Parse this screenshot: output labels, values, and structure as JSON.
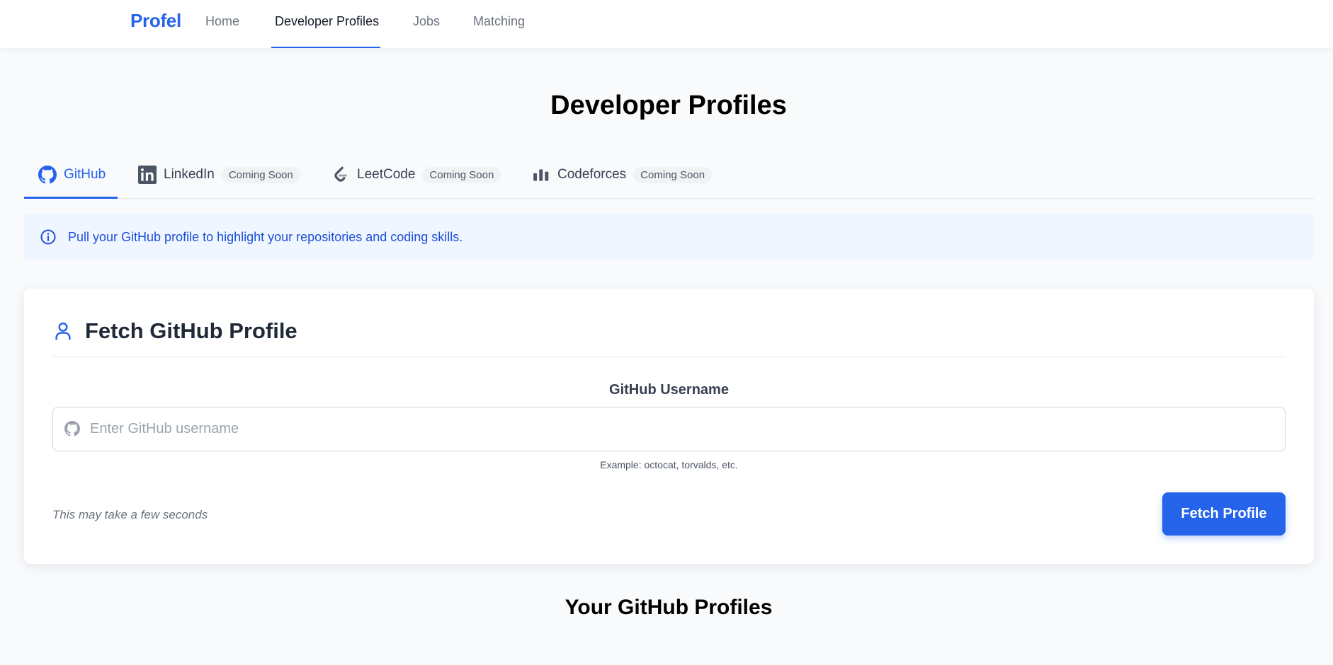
{
  "nav": {
    "brand": "Profel",
    "links": [
      {
        "label": "Home",
        "active": false
      },
      {
        "label": "Developer Profiles",
        "active": true
      },
      {
        "label": "Jobs",
        "active": false
      },
      {
        "label": "Matching",
        "active": false
      }
    ]
  },
  "page": {
    "title": "Developer Profiles"
  },
  "tabs": [
    {
      "label": "GitHub",
      "icon": "github-icon",
      "active": true,
      "badge": ""
    },
    {
      "label": "LinkedIn",
      "icon": "linkedin-icon",
      "active": false,
      "badge": "Coming Soon"
    },
    {
      "label": "LeetCode",
      "icon": "leetcode-icon",
      "active": false,
      "badge": "Coming Soon"
    },
    {
      "label": "Codeforces",
      "icon": "codeforces-icon",
      "active": false,
      "badge": "Coming Soon"
    }
  ],
  "info_banner": {
    "icon": "info-icon",
    "text": "Pull your GitHub profile to highlight your repositories and coding skills."
  },
  "fetch_card": {
    "icon": "user-icon",
    "title": "Fetch GitHub Profile",
    "field_label": "GitHub Username",
    "input_icon": "github-icon",
    "input_value": "",
    "input_placeholder": "Enter GitHub username",
    "hint": "Example: octocat, torvalds, etc.",
    "note": "This may take a few seconds",
    "button_label": "Fetch Profile"
  },
  "profiles_section": {
    "title": "Your GitHub Profiles"
  },
  "colors": {
    "accent": "#2563eb",
    "background": "#f8fafc",
    "info_background": "#eff6ff",
    "info_text": "#1d4ed8",
    "badge_background": "#f1f2f4"
  }
}
